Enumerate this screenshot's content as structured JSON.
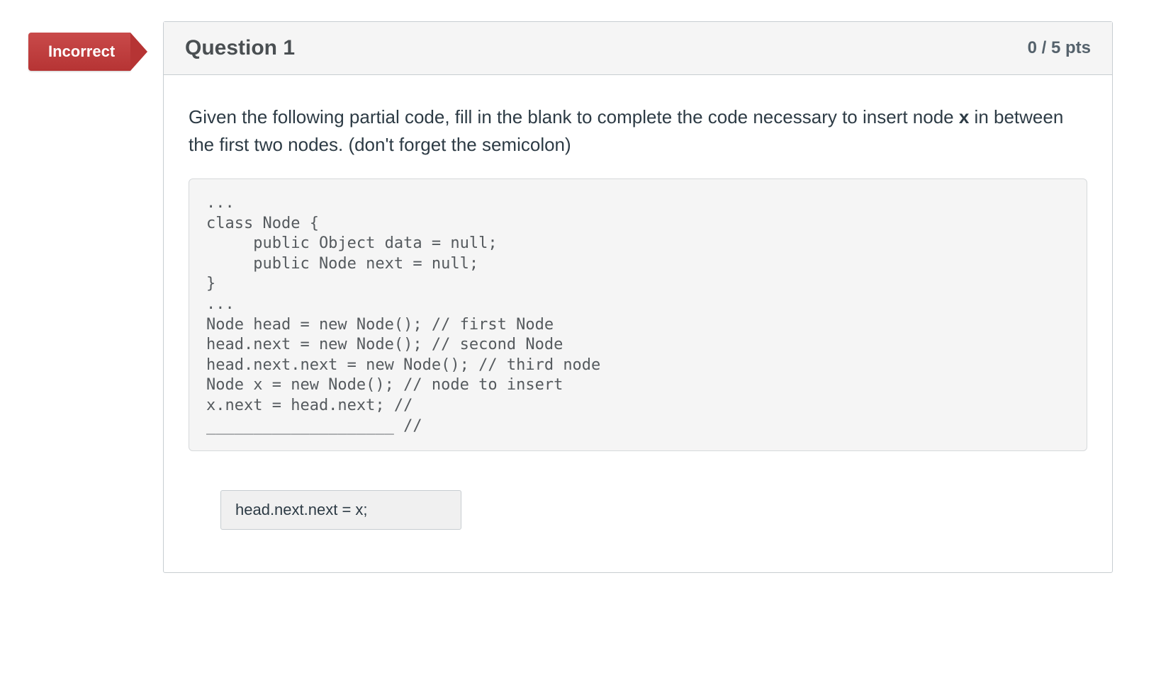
{
  "flag": {
    "label": "Incorrect"
  },
  "question": {
    "title": "Question 1",
    "points": "0 / 5 pts",
    "prompt_pre": "Given the following partial code, fill in the blank to complete the code necessary to insert node ",
    "prompt_bold": "x",
    "prompt_post": " in between the first two nodes. (don't forget the semicolon)",
    "code": "...\nclass Node {\n     public Object data = null;\n     public Node next = null;\n}\n...\nNode head = new Node(); // first Node\nhead.next = new Node(); // second Node\nhead.next.next = new Node(); // third node\nNode x = new Node(); // node to insert\nx.next = head.next; //\n____________________ //",
    "user_answer": "head.next.next = x;"
  }
}
